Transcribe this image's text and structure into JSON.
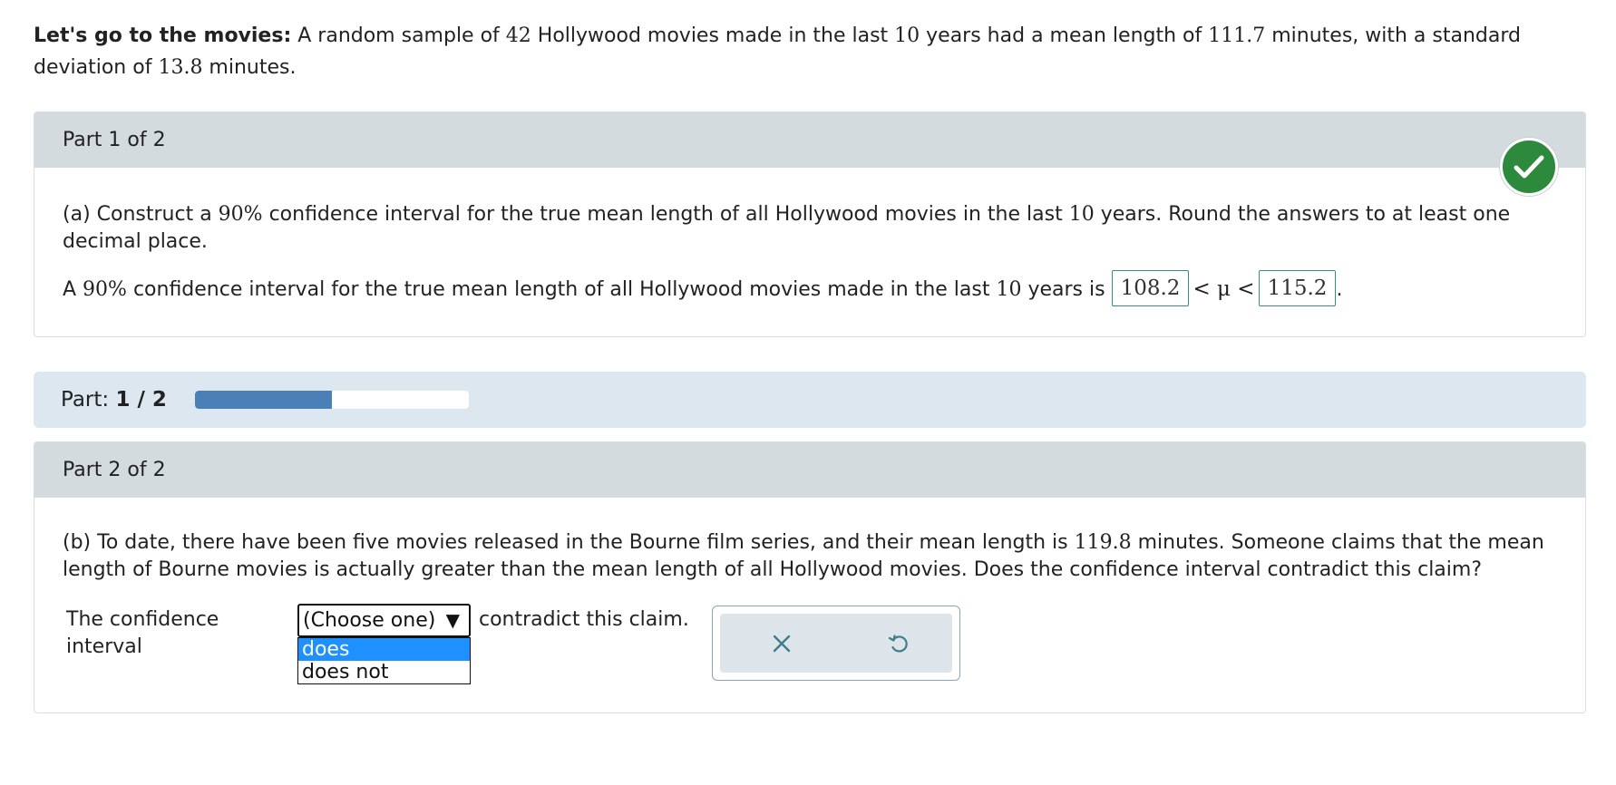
{
  "intro": {
    "lead": "Let's go to the movies:",
    "t1": " A random sample of ",
    "n": "42",
    "t2": " Hollywood movies made in the last ",
    "years": "10",
    "t3": " years had a mean length of ",
    "mean": "111.7",
    "t4": " minutes, with a standard deviation of ",
    "sd": "13.8",
    "t5": " minutes."
  },
  "part1": {
    "header": "Part 1 of 2",
    "status_icon": "check-icon",
    "q_t1": "(a) Construct a ",
    "q_conf": "90%",
    "q_t2": " confidence interval for the true mean length of all Hollywood movies in the last ",
    "q_years": "10",
    "q_t3": " years. Round the answers to at least one decimal place.",
    "a_t1": "A ",
    "a_conf": "90%",
    "a_t2": " confidence interval for the true mean length of all Hollywood movies made in the last ",
    "a_years": "10",
    "a_t3": " years is ",
    "lower": "108.2",
    "mu_expr": "< μ <",
    "upper": "115.2",
    "a_end": "."
  },
  "progress": {
    "label": "Part:",
    "value": "1 / 2",
    "fraction": 0.5,
    "fill_color": "#4a7fb8"
  },
  "part2": {
    "header": "Part 2 of 2",
    "q_t1": "(b) To date, there have been five movies released in the Bourne film series, and their mean length is ",
    "q_mean": "119.8",
    "q_t2": " minutes. Someone claims that the mean length of Bourne movies is actually greater than the mean length of all Hollywood movies. Does the confidence interval contradict this claim?",
    "answer_prefix": "The confidence interval",
    "select_value": "(Choose one)",
    "select_arrow": "▼",
    "options": [
      "does",
      "does not"
    ],
    "answer_suffix": "contradict this claim.",
    "clear_icon": "close-icon",
    "undo_icon": "undo-icon"
  },
  "colors": {
    "success": "#2d8a3c",
    "highlight": "#1e90ff",
    "header_bg": "#d3dbdf",
    "progress_bg": "#dce7f0"
  }
}
